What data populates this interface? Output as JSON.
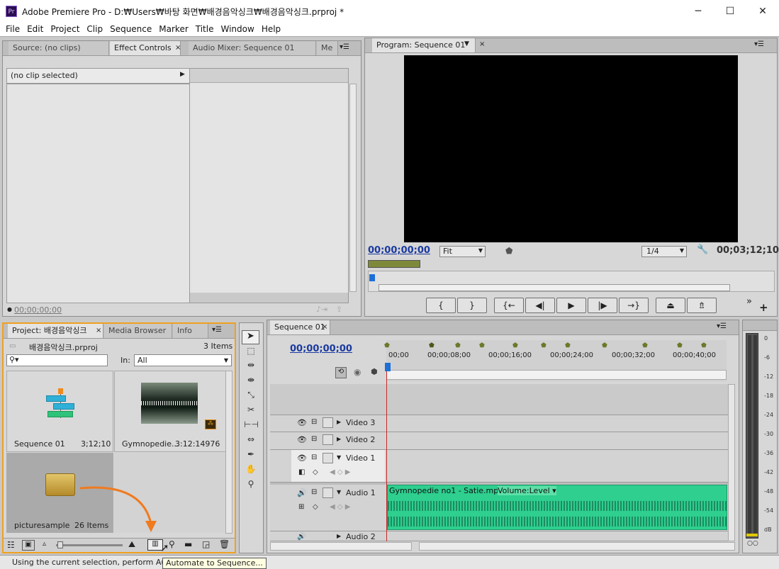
{
  "app": {
    "title": "Adobe Premiere Pro - D:₩Users₩바탕 화면₩배경음악싱크₩배경음악싱크.prproj *",
    "logo": "Pr",
    "window_buttons": [
      "─",
      "☐",
      "✕"
    ]
  },
  "menu": [
    "File",
    "Edit",
    "Project",
    "Clip",
    "Sequence",
    "Marker",
    "Title",
    "Window",
    "Help"
  ],
  "source_panel": {
    "tabs": [
      "Source: (no clips)",
      "Effect Controls",
      "Audio Mixer: Sequence 01",
      "Me"
    ],
    "active_tab": "Effect Controls",
    "no_clip": "(no clip selected)",
    "timecode": "00;00;00;00"
  },
  "program_panel": {
    "tab": "Program: Sequence 01",
    "timecode_current": "00;00;00;00",
    "zoom": "Fit",
    "resolution": "1/4",
    "timecode_duration": "00;03;12;10",
    "transport": [
      "{",
      "}",
      "{←",
      "◀|",
      "▶",
      "|▶",
      "→}"
    ]
  },
  "project_panel": {
    "tabs": [
      "Project: 배경음악싱크",
      "Media Browser",
      "Info"
    ],
    "project_file": "배경음악싱크.prproj",
    "item_count": "3 Items",
    "in_label": "In:",
    "in_value": "All",
    "items": [
      {
        "name": "Sequence 01",
        "duration": "3;12;10"
      },
      {
        "name": "Gymnopedie...",
        "duration": "3:12:14976"
      },
      {
        "name": "picturesample",
        "duration": "26 Items"
      }
    ],
    "status_text": "Using the current selection, perform Auto",
    "tooltip": "Automate to Sequence..."
  },
  "timeline": {
    "tab": "Sequence 01",
    "timecode": "00;00;00;00",
    "ruler": [
      "00;00",
      "00;00;08;00",
      "00;00;16;00",
      "00;00;24;00",
      "00;00;32;00",
      "00;00;40;00"
    ],
    "tracks": [
      {
        "name": "Video 3",
        "type": "video"
      },
      {
        "name": "Video 2",
        "type": "video"
      },
      {
        "name": "Video 1",
        "type": "video"
      },
      {
        "name": "Audio 1",
        "type": "audio"
      },
      {
        "name": "Audio 2",
        "type": "audio"
      }
    ],
    "audio_clip": {
      "name": "Gymnopedie no1 - Satie.mp3",
      "effect": "Volume:Level",
      "color": "#2ecf8f"
    }
  },
  "audio_meter": {
    "labels": [
      "0",
      "-6",
      "-12",
      "-18",
      "-24",
      "-30",
      "-36",
      "-42",
      "-48",
      "-54",
      "dB"
    ]
  },
  "colors": {
    "accent_timecode": "#1b3aa0",
    "playhead": "#c62828",
    "orange_arrow": "#f07a1e"
  }
}
